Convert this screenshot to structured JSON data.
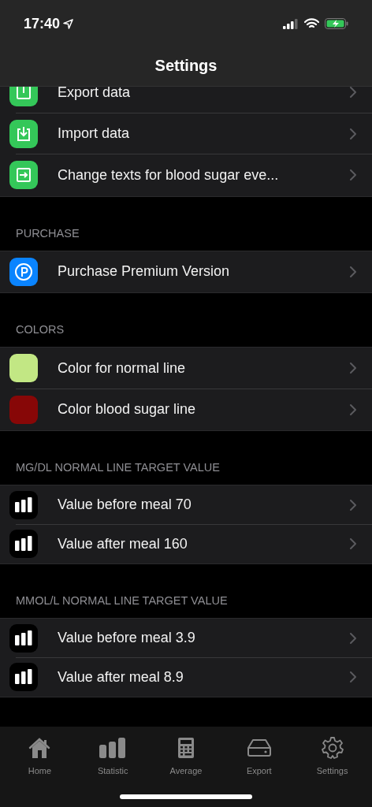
{
  "status_bar": {
    "time": "17:40"
  },
  "window": {
    "title": "Settings"
  },
  "sections": [
    {
      "items": [
        {
          "label": "Export data",
          "kind": "export"
        },
        {
          "label": "Import data",
          "kind": "import"
        },
        {
          "label": "Change texts for blood sugar eve...",
          "kind": "change"
        }
      ]
    },
    {
      "header": "PURCHASE",
      "items": [
        {
          "label": "Purchase Premium Version",
          "kind": "purchase"
        }
      ]
    },
    {
      "header": "COLORS",
      "items": [
        {
          "label": "Color for normal line",
          "kind": "swatch",
          "color": "#c2e784"
        },
        {
          "label": "Color blood sugar line",
          "kind": "swatch",
          "color": "#870707"
        }
      ]
    },
    {
      "header": "MG/DL NORMAL LINE TARGET VALUE",
      "items": [
        {
          "label": "Value before meal 70",
          "kind": "bars"
        },
        {
          "label": "Value after meal 160",
          "kind": "bars"
        }
      ]
    },
    {
      "header": "MMOL/L NORMAL LINE TARGET VALUE",
      "items": [
        {
          "label": "Value before meal 3.9",
          "kind": "bars"
        },
        {
          "label": "Value after meal 8.9",
          "kind": "bars"
        }
      ]
    }
  ],
  "tab_bar": [
    {
      "label": "Home",
      "kind": "home"
    },
    {
      "label": "Statistic",
      "kind": "bars"
    },
    {
      "label": "Average",
      "kind": "calculator"
    },
    {
      "label": "Export",
      "kind": "drive"
    },
    {
      "label": "Settings",
      "kind": "gear"
    }
  ]
}
